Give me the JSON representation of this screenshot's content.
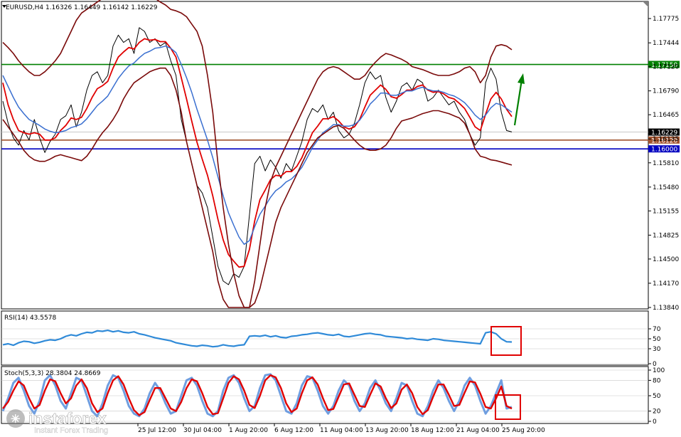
{
  "header": {
    "title": "EURUSD,H4  1.16326 1.16449 1.16142 1.16229"
  },
  "rsi_label": "RSI(14) 43.5578",
  "stoch_label": "Stoch(5,3,3) 28.3804 24.8669",
  "watermark": {
    "brand": "instaforex",
    "tagline": "Instant Forex Trading"
  },
  "colors": {
    "price": "#000000",
    "bollinger": "#7a0a0a",
    "fast_ma": "#e00000",
    "slow_ma": "#3a6fd0",
    "rsi": "#2f8ad8",
    "stoch_main": "#e00000",
    "stoch_signal": "#6f9ee0",
    "resistance": "#008000",
    "support": "#0000c0",
    "current": "#a0522d",
    "arrow": "#008000",
    "highlight": "#e00000"
  },
  "chart_data": [
    {
      "type": "line",
      "title": "EURUSD,H4  1.16326 1.16449 1.16142 1.16229",
      "y_ticks": [
        "1.17775",
        "1.17444",
        "1.17120",
        "1.16790",
        "1.16465",
        "1.16135",
        "1.15810",
        "1.15480",
        "1.15155",
        "1.14825",
        "1.14500",
        "1.14170",
        "1.13840"
      ],
      "ylim": [
        1.1384,
        1.1795
      ],
      "x_tick_labels": [
        "25 Jul 12:00",
        "30 Jul 04:00",
        "1 Aug 20:00",
        "6 Aug 12:00",
        "11 Aug 04:00",
        "13 Aug 20:00",
        "18 Aug 12:00",
        "21 Aug 04:00",
        "25 Aug 20:00"
      ],
      "horizontal_levels": [
        {
          "label": "1.17150",
          "value": 1.1715,
          "color": "#008000"
        },
        {
          "label": "1.16229",
          "value": 1.16229,
          "color": "#000000"
        },
        {
          "label": "1.16120",
          "value": 1.1612,
          "color": "#a0522d"
        },
        {
          "label": "1.16000",
          "value": 1.16,
          "color": "#0000c0"
        }
      ],
      "series": [
        {
          "values": [
            1.1665,
            1.1635,
            1.1615,
            1.1605,
            1.1625,
            1.1612,
            1.164,
            1.1615,
            1.1595,
            1.161,
            1.162,
            1.164,
            1.1645,
            1.166,
            1.163,
            1.165,
            1.168,
            1.17,
            1.1705,
            1.169,
            1.17,
            1.174,
            1.1755,
            1.1745,
            1.175,
            1.173,
            1.1765,
            1.176,
            1.1745,
            1.175,
            1.174,
            1.1745,
            1.172,
            1.17,
            1.164,
            1.161,
            1.158,
            1.155,
            1.154,
            1.152,
            1.148,
            1.144,
            1.142,
            1.1415,
            1.143,
            1.1425,
            1.144,
            1.151,
            1.158,
            1.159,
            1.157,
            1.1585,
            1.1575,
            1.156,
            1.158,
            1.157,
            1.159,
            1.161,
            1.164,
            1.1655,
            1.165,
            1.166,
            1.164,
            1.165,
            1.1625,
            1.1615,
            1.162,
            1.1635,
            1.166,
            1.169,
            1.1705,
            1.1695,
            1.17,
            1.167,
            1.165,
            1.1665,
            1.1685,
            1.169,
            1.168,
            1.1695,
            1.169,
            1.1665,
            1.167,
            1.168,
            1.167,
            1.166,
            1.1665,
            1.165,
            1.164,
            1.162,
            1.1605,
            1.1615,
            1.169,
            1.171,
            1.1695,
            1.165,
            1.1625,
            1.1623
          ]
        },
        {
          "values": [
            1.169,
            1.166,
            1.164,
            1.1625,
            1.1622,
            1.162,
            1.1622,
            1.162,
            1.1612,
            1.1612,
            1.1615,
            1.1625,
            1.1632,
            1.1642,
            1.164,
            1.1643,
            1.1655,
            1.167,
            1.1682,
            1.1686,
            1.1692,
            1.171,
            1.1725,
            1.1732,
            1.1738,
            1.1736,
            1.1745,
            1.175,
            1.1748,
            1.1749,
            1.1746,
            1.1746,
            1.1737,
            1.1725,
            1.1697,
            1.1668,
            1.1638,
            1.1609,
            1.1586,
            1.1564,
            1.1536,
            1.1504,
            1.1476,
            1.1456,
            1.1447,
            1.1439,
            1.144,
            1.1463,
            1.1502,
            1.1531,
            1.1544,
            1.1558,
            1.1564,
            1.1563,
            1.1569,
            1.1569,
            1.1576,
            1.1588,
            1.1605,
            1.1622,
            1.1631,
            1.1641,
            1.1641,
            1.1644,
            1.1638,
            1.163,
            1.1627,
            1.163,
            1.164,
            1.1657,
            1.1673,
            1.168,
            1.1687,
            1.1681,
            1.1671,
            1.1669,
            1.1674,
            1.168,
            1.168,
            1.1685,
            1.1687,
            1.168,
            1.1677,
            1.1678,
            1.1675,
            1.167,
            1.1668,
            1.1662,
            1.1655,
            1.1643,
            1.163,
            1.1625,
            1.1647,
            1.1668,
            1.1677,
            1.1668,
            1.1654,
            1.1644
          ]
        },
        {
          "values": [
            1.17,
            1.1685,
            1.167,
            1.1657,
            1.1648,
            1.164,
            1.1636,
            1.1632,
            1.1627,
            1.1624,
            1.1622,
            1.1623,
            1.1625,
            1.1629,
            1.1631,
            1.1634,
            1.1641,
            1.165,
            1.1659,
            1.1665,
            1.1672,
            1.1684,
            1.1696,
            1.1705,
            1.1713,
            1.1717,
            1.1724,
            1.173,
            1.1733,
            1.1737,
            1.1738,
            1.174,
            1.1737,
            1.1731,
            1.1715,
            1.1697,
            1.1677,
            1.1654,
            1.1633,
            1.1612,
            1.1588,
            1.1562,
            1.1536,
            1.1513,
            1.1496,
            1.148,
            1.147,
            1.1475,
            1.1494,
            1.1511,
            1.1522,
            1.1534,
            1.1543,
            1.1548,
            1.1555,
            1.1559,
            1.1566,
            1.1575,
            1.1588,
            1.1602,
            1.1612,
            1.1622,
            1.1627,
            1.1633,
            1.1633,
            1.1631,
            1.1631,
            1.1633,
            1.1639,
            1.1649,
            1.1661,
            1.1668,
            1.1676,
            1.1676,
            1.1673,
            1.1673,
            1.1676,
            1.1679,
            1.1679,
            1.1682,
            1.1684,
            1.1681,
            1.1679,
            1.1679,
            1.1677,
            1.1674,
            1.1672,
            1.1668,
            1.1663,
            1.1655,
            1.1646,
            1.164,
            1.1646,
            1.1656,
            1.1662,
            1.166,
            1.1655,
            1.165
          ]
        },
        {
          "values": [
            1.1745,
            1.1738,
            1.173,
            1.172,
            1.1712,
            1.1705,
            1.17,
            1.17,
            1.1705,
            1.1712,
            1.172,
            1.173,
            1.1745,
            1.176,
            1.1775,
            1.1785,
            1.179,
            1.1795,
            1.18,
            1.1805,
            1.181,
            1.1815,
            1.182,
            1.1822,
            1.1822,
            1.1818,
            1.1812,
            1.181,
            1.1808,
            1.1805,
            1.18,
            1.1796,
            1.179,
            1.1788,
            1.1785,
            1.178,
            1.177,
            1.176,
            1.174,
            1.17,
            1.165,
            1.158,
            1.152,
            1.147,
            1.143,
            1.14,
            1.1384,
            1.1384,
            1.142,
            1.147,
            1.152,
            1.1555,
            1.1575,
            1.159,
            1.1605,
            1.162,
            1.1635,
            1.165,
            1.1665,
            1.168,
            1.1695,
            1.1705,
            1.171,
            1.1712,
            1.171,
            1.1705,
            1.17,
            1.1695,
            1.1695,
            1.17,
            1.171,
            1.1718,
            1.1725,
            1.173,
            1.1728,
            1.1725,
            1.1722,
            1.1718,
            1.1712,
            1.171,
            1.1708,
            1.1705,
            1.1702,
            1.17,
            1.17,
            1.17,
            1.1702,
            1.1705,
            1.171,
            1.1712,
            1.1705,
            1.169,
            1.17,
            1.1725,
            1.174,
            1.1742,
            1.174,
            1.1735
          ]
        },
        {
          "values": [
            1.164,
            1.163,
            1.162,
            1.161,
            1.1598,
            1.159,
            1.1585,
            1.1583,
            1.1583,
            1.1586,
            1.159,
            1.1592,
            1.159,
            1.1588,
            1.1586,
            1.1584,
            1.159,
            1.16,
            1.1612,
            1.1622,
            1.163,
            1.164,
            1.1652,
            1.1668,
            1.168,
            1.169,
            1.1695,
            1.17,
            1.1705,
            1.1708,
            1.171,
            1.171,
            1.17,
            1.168,
            1.165,
            1.161,
            1.158,
            1.155,
            1.152,
            1.149,
            1.146,
            1.142,
            1.1395,
            1.1384,
            1.1384,
            1.1384,
            1.1384,
            1.1384,
            1.139,
            1.141,
            1.144,
            1.147,
            1.15,
            1.152,
            1.1535,
            1.155,
            1.1565,
            1.158,
            1.1595,
            1.1605,
            1.1615,
            1.162,
            1.1625,
            1.163,
            1.1632,
            1.1628,
            1.162,
            1.1612,
            1.1605,
            1.16,
            1.1598,
            1.1598,
            1.16,
            1.1605,
            1.1615,
            1.1628,
            1.1638,
            1.164,
            1.1642,
            1.1645,
            1.1648,
            1.165,
            1.1652,
            1.1652,
            1.165,
            1.1648,
            1.1645,
            1.1642,
            1.1635,
            1.162,
            1.16,
            1.159,
            1.1588,
            1.1585,
            1.1584,
            1.1582,
            1.158,
            1.1578
          ]
        }
      ]
    },
    {
      "type": "line",
      "title": "RSI(14) 43.5578",
      "y_ticks": [
        "70",
        "50",
        "30",
        "0"
      ],
      "ylim": [
        0,
        100
      ],
      "series": [
        {
          "values": [
            38,
            40,
            37,
            42,
            45,
            44,
            41,
            43,
            46,
            48,
            47,
            50,
            55,
            58,
            56,
            60,
            63,
            62,
            66,
            65,
            67,
            64,
            66,
            63,
            62,
            64,
            60,
            58,
            55,
            52,
            50,
            48,
            46,
            42,
            40,
            38,
            36,
            35,
            37,
            36,
            34,
            35,
            38,
            36,
            35,
            37,
            38,
            55,
            56,
            55,
            57,
            54,
            56,
            53,
            52,
            55,
            56,
            58,
            59,
            61,
            62,
            60,
            58,
            57,
            59,
            55,
            54,
            56,
            58,
            60,
            61,
            59,
            58,
            55,
            54,
            53,
            52,
            50,
            51,
            49,
            48,
            47,
            50,
            49,
            47,
            46,
            45,
            44,
            43,
            42,
            41,
            40,
            62,
            64,
            60,
            50,
            44,
            43.6
          ]
        }
      ]
    },
    {
      "type": "line",
      "title": "Stoch(5,3,3) 28.3804 24.8669",
      "y_ticks": [
        "100",
        "80",
        "50",
        "20",
        "0"
      ],
      "ylim": [
        0,
        100
      ],
      "series": [
        {
          "values": [
            20,
            45,
            75,
            85,
            60,
            30,
            15,
            40,
            80,
            90,
            70,
            40,
            25,
            55,
            85,
            80,
            50,
            20,
            10,
            35,
            70,
            90,
            85,
            60,
            30,
            15,
            10,
            25,
            55,
            75,
            60,
            35,
            15,
            20,
            50,
            80,
            85,
            70,
            40,
            15,
            10,
            20,
            60,
            85,
            90,
            75,
            45,
            20,
            30,
            65,
            90,
            92,
            80,
            50,
            20,
            15,
            35,
            70,
            88,
            85,
            60,
            30,
            15,
            30,
            60,
            80,
            70,
            40,
            20,
            35,
            65,
            80,
            60,
            35,
            20,
            45,
            75,
            70,
            40,
            15,
            10,
            30,
            60,
            80,
            65,
            40,
            20,
            40,
            70,
            85,
            70,
            40,
            15,
            30,
            55,
            80,
            25,
            28
          ]
        },
        {
          "values": [
            25,
            38,
            60,
            78,
            70,
            45,
            25,
            32,
            60,
            82,
            78,
            55,
            35,
            45,
            70,
            82,
            65,
            35,
            18,
            25,
            55,
            80,
            88,
            72,
            45,
            22,
            12,
            18,
            42,
            65,
            65,
            45,
            25,
            20,
            38,
            65,
            82,
            78,
            55,
            28,
            14,
            16,
            45,
            75,
            88,
            82,
            60,
            32,
            26,
            50,
            80,
            90,
            86,
            65,
            35,
            18,
            25,
            55,
            80,
            86,
            72,
            45,
            22,
            24,
            48,
            72,
            74,
            52,
            30,
            28,
            52,
            74,
            68,
            45,
            26,
            35,
            62,
            72,
            55,
            28,
            14,
            22,
            48,
            72,
            72,
            52,
            30,
            32,
            56,
            78,
            76,
            54,
            28,
            25,
            45,
            68,
            30,
            25
          ]
        }
      ]
    }
  ]
}
